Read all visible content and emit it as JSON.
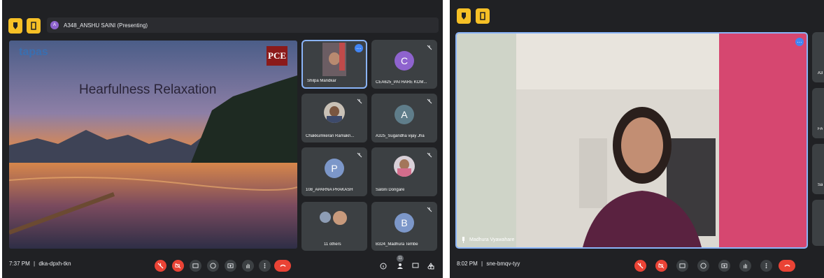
{
  "left_meeting": {
    "presenting_banner": "A348_ANSHU SAINI (Presenting)",
    "presenter_initial": "A",
    "slide": {
      "title": "Hearfulness Relaxation",
      "logo_left": "tapas",
      "logo_right": "PCE"
    },
    "participants": [
      {
        "name": "Shilpa Mandkar",
        "type": "photo"
      },
      {
        "name": "CEA625_PATHARE KOM...",
        "type": "initial",
        "initial": "C",
        "color": "#8e63ce"
      },
      {
        "name": "Chakkumkeran Ramakri...",
        "type": "photo"
      },
      {
        "name": "A325_Sugandha vijay Jha",
        "type": "initial",
        "initial": "A",
        "color": "#5f7d8a"
      },
      {
        "name": "108_APARNA PRAKASH",
        "type": "initial",
        "initial": "P",
        "color": "#7c97c9"
      },
      {
        "name": "Saloni Dongare",
        "type": "photo"
      },
      {
        "name": "11 others",
        "type": "group"
      },
      {
        "name": "B324_Madhura Tembe",
        "type": "initial",
        "initial": "B",
        "color": "#7c97c9"
      }
    ],
    "time": "7:37 PM",
    "separator": "|",
    "meeting_code": "dka-dpxh-tkn",
    "participant_badge": "11"
  },
  "right_meeting": {
    "speaker_name": "Madhura Vyawahare",
    "time": "8:02 PM",
    "separator": "|",
    "meeting_code": "sne-bmqv-tyy",
    "side_labels": [
      "A3",
      "FA",
      "Sa"
    ]
  },
  "colors": {
    "background": "#202124",
    "tile": "#3c4043",
    "end_call": "#ea4335",
    "accent_yellow": "#f6c026",
    "active_border": "#8ab4f8"
  }
}
